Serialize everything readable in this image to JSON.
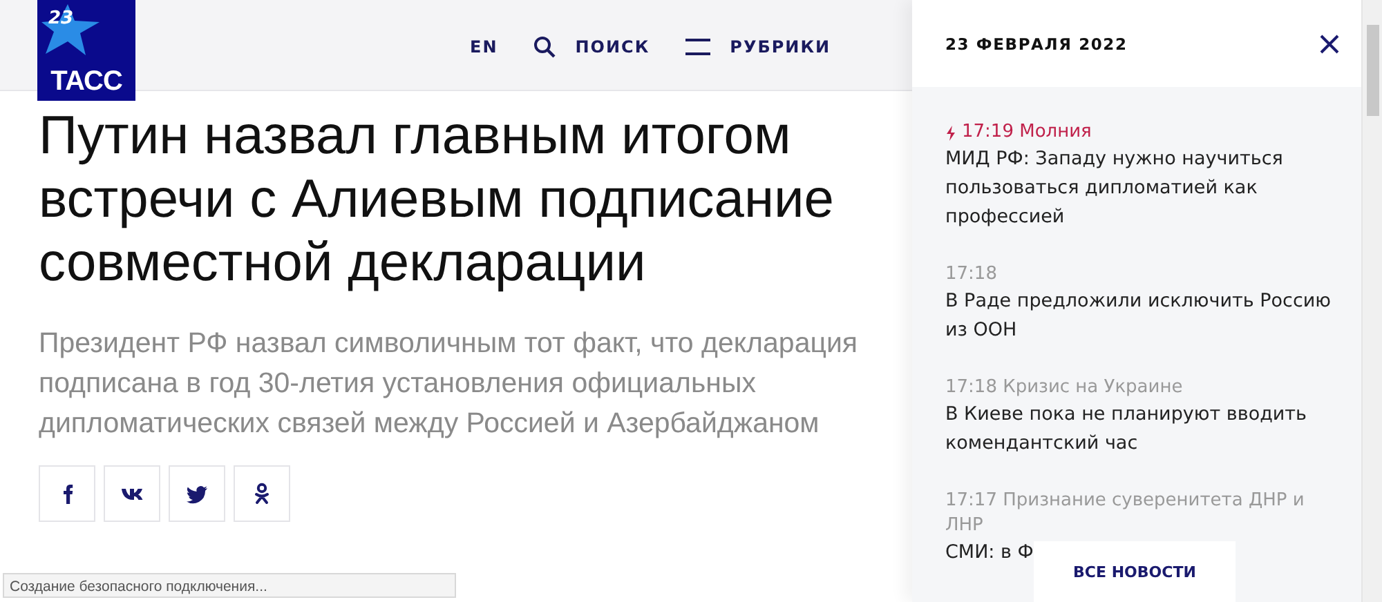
{
  "logo": {
    "number": "23",
    "name": "ТАСС"
  },
  "nav": [
    {
      "kind": "lang",
      "label": "EN"
    },
    {
      "kind": "search",
      "label": "ПОИСК"
    },
    {
      "kind": "menu",
      "label": "РУБРИКИ"
    }
  ],
  "article": {
    "headline": "Путин назвал главным итогом встречи с Алиевым подписание совместной декларации",
    "lead": "Президент РФ назвал символичным тот факт, что декларация подписана в год 30-летия установления официальных дипломатических связей между Россией и Азербайджаном"
  },
  "share": [
    {
      "kind": "facebook"
    },
    {
      "kind": "vk"
    },
    {
      "kind": "twitter"
    },
    {
      "kind": "ok"
    }
  ],
  "news_panel": {
    "date": "23 ФЕВРАЛЯ 2022",
    "items": [
      {
        "time": "17:19",
        "tag": "Молния",
        "urgent": true,
        "title": "МИД РФ: Западу нужно научиться пользоваться дипломатией как профессией"
      },
      {
        "time": "17:18",
        "urgent": false,
        "title": "В Раде предложили исключить Россию из ООН"
      },
      {
        "time": "17:18",
        "tag": "Кризис на Украине",
        "urgent": false,
        "title": "В Киеве пока не планируют вводить комендантский час"
      },
      {
        "time": "17:17",
        "tag": "Признание суверенитета ДНР и ЛНР",
        "urgent": false,
        "title": "СМИ: в Ф"
      }
    ],
    "all_news_button": "ВСЕ НОВОСТИ"
  },
  "status_bar": "Создание безопасного подключения..."
}
